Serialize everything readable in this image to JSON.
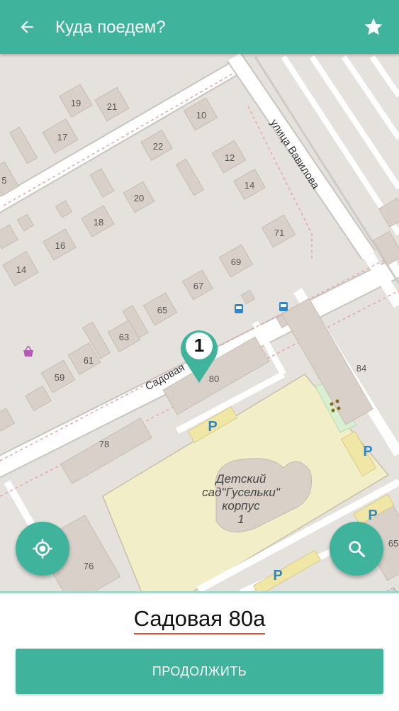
{
  "appbar": {
    "title": "Куда поедем?",
    "back_icon": "arrow-back-icon",
    "star_icon": "star-icon"
  },
  "map": {
    "streets": [
      "Садовая",
      "улица Вавилова",
      "улица Менделеева"
    ],
    "house_numbers": [
      "19",
      "21",
      "10",
      "17",
      "22",
      "12",
      "5",
      "14",
      "20",
      "18",
      "16",
      "71",
      "14",
      "69",
      "67",
      "65",
      "63",
      "61",
      "59",
      "80",
      "84",
      "78",
      "76",
      "65"
    ],
    "kindergarten": [
      "Детский",
      "сад\"Гусельки\"",
      "корпус",
      "1"
    ],
    "parking_label": "P",
    "marker_number": "1"
  },
  "fabs": {
    "locate_icon": "my-location-icon",
    "search_icon": "search-icon"
  },
  "bottom": {
    "address": "Садовая 80а",
    "continue_label": "ПРОДОЛЖИТЬ"
  },
  "colors": {
    "accent": "#3fb39c",
    "underline": "#e0532d"
  }
}
